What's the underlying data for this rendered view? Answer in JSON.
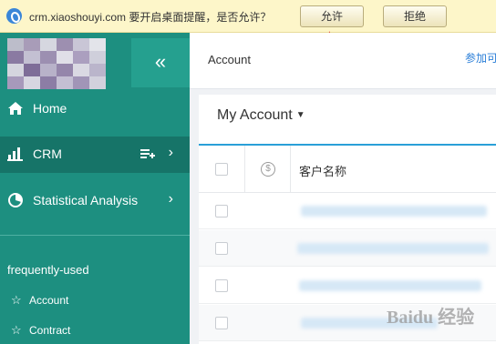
{
  "notification": {
    "message": "crm.xiaoshouyi.com 要开启桌面提醒，是否允许？",
    "allow_label": "允许",
    "deny_label": "拒绝"
  },
  "sidebar": {
    "collapse_icon": "«",
    "items": [
      {
        "label": "Home",
        "icon": "home-icon"
      },
      {
        "label": "CRM",
        "icon": "bar-chart-icon"
      },
      {
        "label": "Statistical Analysis",
        "icon": "pie-chart-icon"
      }
    ],
    "frequently_used_label": "frequently-used",
    "frequent": [
      {
        "label": "Account",
        "icon": "star-icon"
      },
      {
        "label": "Contract",
        "icon": "star-icon"
      }
    ]
  },
  "header": {
    "breadcrumb": "Account",
    "add_link": "参加可"
  },
  "list": {
    "view_title": "My Account",
    "column_name": "客户名称",
    "row_count": 4
  },
  "colors": {
    "sidebar": "#1d8f80",
    "sidebar_active": "#167468",
    "accent": "#2aa0d8",
    "notify_bg": "#fdf6c9",
    "arrow": "#e02020"
  },
  "watermark": "Baidu 经验"
}
